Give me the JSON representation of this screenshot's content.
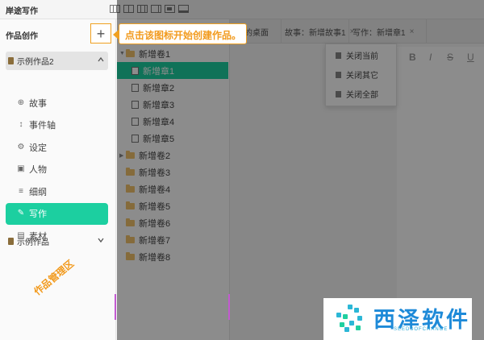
{
  "app": {
    "title": "岸途写作"
  },
  "sidebar": {
    "header": "作品创作",
    "add_symbol": "+",
    "projects": [
      {
        "label": "示例作品2",
        "expanded": true
      },
      {
        "label": "示例作品",
        "expanded": false
      }
    ],
    "nav": [
      {
        "label": "故事",
        "icon": "globe-icon"
      },
      {
        "label": "事件轴",
        "icon": "sort-icon"
      },
      {
        "label": "设定",
        "icon": "gears-icon"
      },
      {
        "label": "人物",
        "icon": "id-card-icon"
      },
      {
        "label": "细纲",
        "icon": "list-icon"
      },
      {
        "label": "写作",
        "icon": "pencil-icon",
        "active": true
      },
      {
        "label": "素材",
        "icon": "image-icon"
      }
    ],
    "annotation": "作品管理区"
  },
  "callout": {
    "text": "点击该图标开始创建作品。"
  },
  "tree": {
    "rows": [
      {
        "label": "新增卷1",
        "type": "volume",
        "expanded": true
      },
      {
        "label": "新增章1",
        "type": "chapter",
        "selected": true
      },
      {
        "label": "新增章2",
        "type": "chapter"
      },
      {
        "label": "新增章3",
        "type": "chapter"
      },
      {
        "label": "新增章4",
        "type": "chapter"
      },
      {
        "label": "新增章5",
        "type": "chapter"
      },
      {
        "label": "新增卷2",
        "type": "volume",
        "expanded": false
      },
      {
        "label": "新增卷3",
        "type": "volume"
      },
      {
        "label": "新增卷4",
        "type": "volume"
      },
      {
        "label": "新增卷5",
        "type": "volume"
      },
      {
        "label": "新增卷6",
        "type": "volume"
      },
      {
        "label": "新增卷7",
        "type": "volume"
      },
      {
        "label": "新增卷8",
        "type": "volume"
      }
    ]
  },
  "editor": {
    "tabs": [
      {
        "label": "的桌面"
      },
      {
        "label": "故事：新增故事1",
        "close": "×"
      },
      {
        "label": "写作：新增章1",
        "close": "×"
      }
    ],
    "format_buttons": [
      "B",
      "I",
      "S",
      "U"
    ],
    "context_menu": [
      {
        "label": "关闭当前",
        "icon": "file-icon"
      },
      {
        "label": "关闭其它",
        "icon": "copy-icon"
      },
      {
        "label": "关闭全部",
        "icon": "grid-icon"
      }
    ]
  },
  "watermark": {
    "main": "西泽软件",
    "sub": "SEEDSOFCHANGE"
  },
  "colors": {
    "accent": "#1ccfa0",
    "highlight": "#f0a020",
    "brand_blue": "#1e8ad8"
  }
}
